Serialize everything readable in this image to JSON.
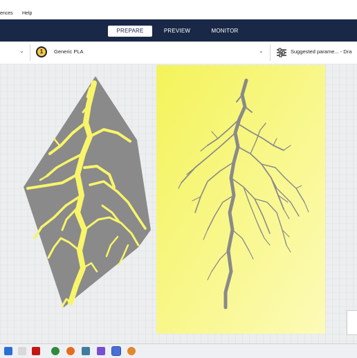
{
  "menu": {
    "item_preferences": "ences",
    "item_help": "Help"
  },
  "stages": [
    {
      "label": "PREPARE",
      "active": true
    },
    {
      "label": "PREVIEW",
      "active": false
    },
    {
      "label": "MONITOR",
      "active": false
    }
  ],
  "toolbar": {
    "extruder_number": "1",
    "material": "Generic PLA",
    "print_settings": "Suggested parame... - Dra"
  },
  "colors": {
    "header": "#1a2847",
    "model_yellow": "#f8f56a",
    "model_gray": "#8a8a8a",
    "build_plate": "#eceeef"
  },
  "taskbar": {
    "icons": [
      "windows-icon",
      "search-icon",
      "xbox-icon",
      "netflix-icon",
      "browser-icon",
      "firefox-icon",
      "file-explorer-icon",
      "app-icon",
      "teams-icon",
      "cura-icon",
      "blender-icon"
    ]
  }
}
